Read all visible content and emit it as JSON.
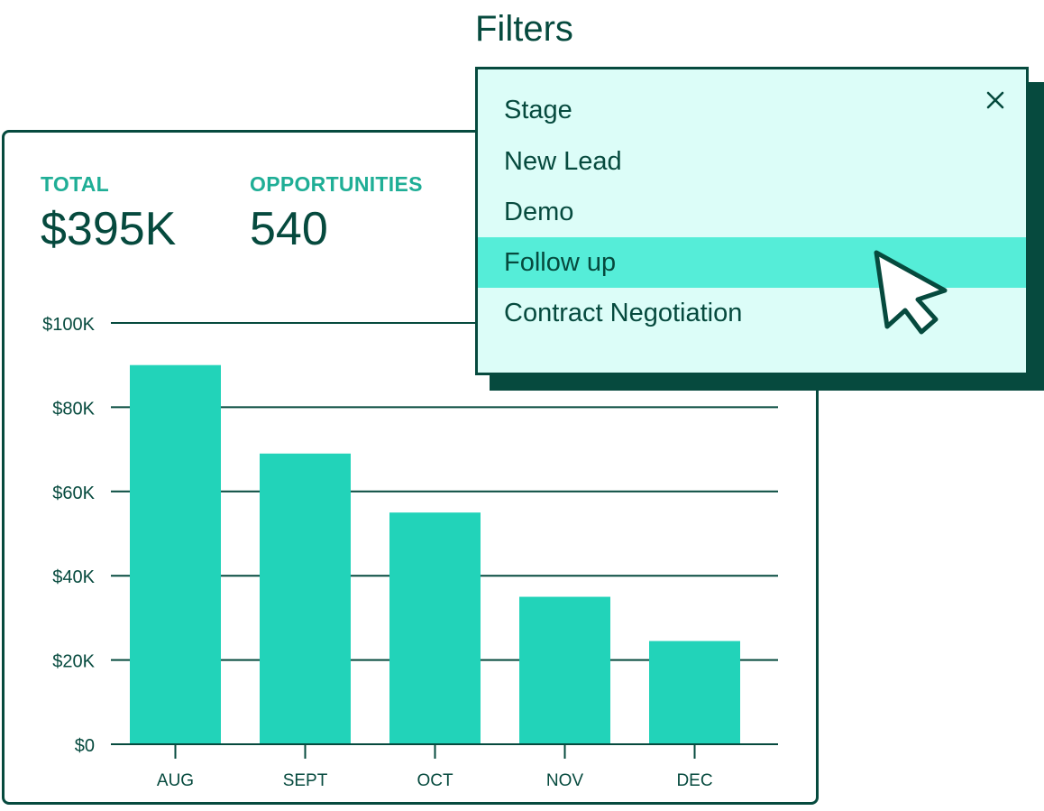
{
  "filters": {
    "title": "Filters",
    "options": [
      {
        "label": "Stage",
        "highlighted": false
      },
      {
        "label": "New Lead",
        "highlighted": false
      },
      {
        "label": "Demo",
        "highlighted": false
      },
      {
        "label": "Follow up",
        "highlighted": true
      },
      {
        "label": "Contract Negotiation",
        "highlighted": false
      }
    ],
    "close_icon": "close-icon"
  },
  "kpis": {
    "total_label": "TOTAL",
    "total_value": "$395K",
    "opportunities_label": "OPPORTUNITIES",
    "opportunities_value": "540"
  },
  "colors": {
    "dark": "#064a3e",
    "accent": "#22d3b9",
    "label_accent": "#1fae96",
    "panel_bg": "#dcfdf8",
    "highlight": "#55edd8"
  },
  "cursor_icon": "arrow-cursor-icon",
  "chart_data": {
    "type": "bar",
    "categories": [
      "AUG",
      "SEPT",
      "OCT",
      "NOV",
      "DEC"
    ],
    "values": [
      90000,
      69000,
      55000,
      35000,
      24500
    ],
    "ylim": [
      0,
      100000
    ],
    "yticks": [
      {
        "value": 0,
        "label": "$0"
      },
      {
        "value": 20000,
        "label": "$20K"
      },
      {
        "value": 40000,
        "label": "$40K"
      },
      {
        "value": 60000,
        "label": "$60K"
      },
      {
        "value": 80000,
        "label": "$80K"
      },
      {
        "value": 100000,
        "label": "$100K"
      }
    ],
    "grid": true,
    "title": "",
    "xlabel": "",
    "ylabel": ""
  }
}
